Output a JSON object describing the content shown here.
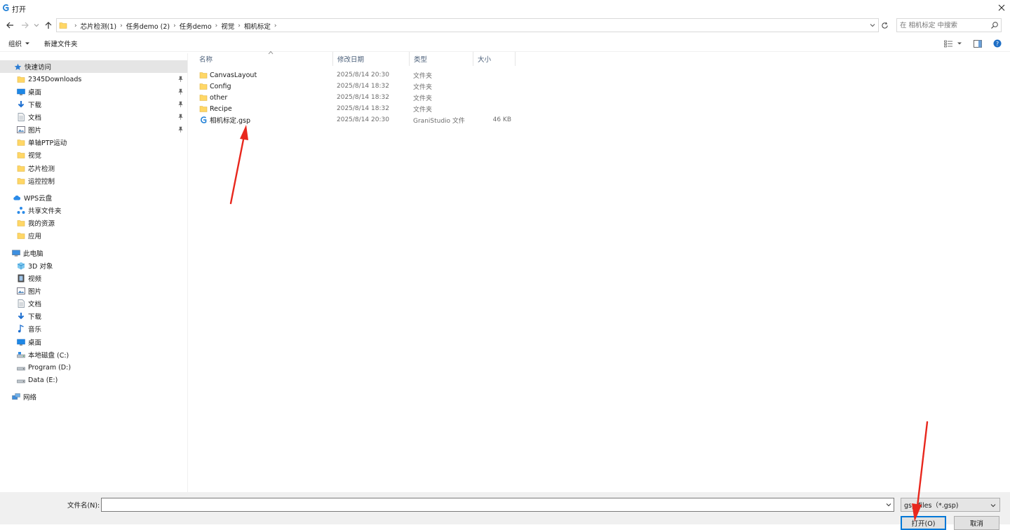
{
  "window": {
    "title": "打开"
  },
  "address": {
    "crumbs": [
      "芯片检测(1)",
      "任务demo (2)",
      "任务demo",
      "视觉",
      "相机标定"
    ],
    "search_placeholder": "在 相机标定 中搜索"
  },
  "toolbar": {
    "organize_label": "组织",
    "new_folder_label": "新建文件夹"
  },
  "sidebar": {
    "quick_access": {
      "label": "快速访问",
      "items": [
        {
          "label": "2345Downloads",
          "icon": "folder-icon",
          "pinned": true
        },
        {
          "label": "桌面",
          "icon": "desktop-icon",
          "pinned": true
        },
        {
          "label": "下载",
          "icon": "download-icon",
          "pinned": true
        },
        {
          "label": "文档",
          "icon": "document-icon",
          "pinned": true
        },
        {
          "label": "图片",
          "icon": "picture-icon",
          "pinned": true
        },
        {
          "label": "单轴PTP运动",
          "icon": "folder-icon",
          "pinned": false
        },
        {
          "label": "视觉",
          "icon": "folder-icon",
          "pinned": false
        },
        {
          "label": "芯片检测",
          "icon": "folder-icon",
          "pinned": false
        },
        {
          "label": "运控控制",
          "icon": "folder-icon",
          "pinned": false
        }
      ]
    },
    "wps": {
      "label": "WPS云盘",
      "items": [
        {
          "label": "共享文件夹",
          "icon": "share-icon"
        },
        {
          "label": "我的资源",
          "icon": "folder-icon"
        },
        {
          "label": "应用",
          "icon": "folder-icon"
        }
      ]
    },
    "this_pc": {
      "label": "此电脑",
      "items": [
        {
          "label": "3D 对象",
          "icon": "cube-icon"
        },
        {
          "label": "视频",
          "icon": "video-icon"
        },
        {
          "label": "图片",
          "icon": "picture-icon"
        },
        {
          "label": "文档",
          "icon": "document-icon"
        },
        {
          "label": "下载",
          "icon": "download-icon"
        },
        {
          "label": "音乐",
          "icon": "music-icon"
        },
        {
          "label": "桌面",
          "icon": "desktop-icon"
        },
        {
          "label": "本地磁盘 (C:)",
          "icon": "drive-icon"
        },
        {
          "label": "Program (D:)",
          "icon": "drive-icon"
        },
        {
          "label": "Data (E:)",
          "icon": "drive-icon"
        }
      ]
    },
    "network": {
      "label": "网络"
    }
  },
  "filelist": {
    "columns": [
      "名称",
      "修改日期",
      "类型",
      "大小"
    ],
    "rows": [
      {
        "name": "CanvasLayout",
        "date": "2025/8/14 20:30",
        "type": "文件夹",
        "size": "",
        "icon": "folder-icon"
      },
      {
        "name": "Config",
        "date": "2025/8/14 18:32",
        "type": "文件夹",
        "size": "",
        "icon": "folder-icon"
      },
      {
        "name": "other",
        "date": "2025/8/14 18:32",
        "type": "文件夹",
        "size": "",
        "icon": "folder-icon"
      },
      {
        "name": "Recipe",
        "date": "2025/8/14 18:32",
        "type": "文件夹",
        "size": "",
        "icon": "folder-icon"
      },
      {
        "name": "相机标定.gsp",
        "date": "2025/8/14 20:30",
        "type": "GraniStudio 文件",
        "size": "46 KB",
        "icon": "gsp-file-icon"
      }
    ]
  },
  "bottom": {
    "filename_label": "文件名(N):",
    "filename_value": "",
    "filetype_value": "gsp files（*.gsp)",
    "open_label": "打开(O)",
    "cancel_label": "取消"
  },
  "colors": {
    "accent": "#0078d7",
    "folder": "#ffd766",
    "annotation_arrow": "#e8271d"
  }
}
